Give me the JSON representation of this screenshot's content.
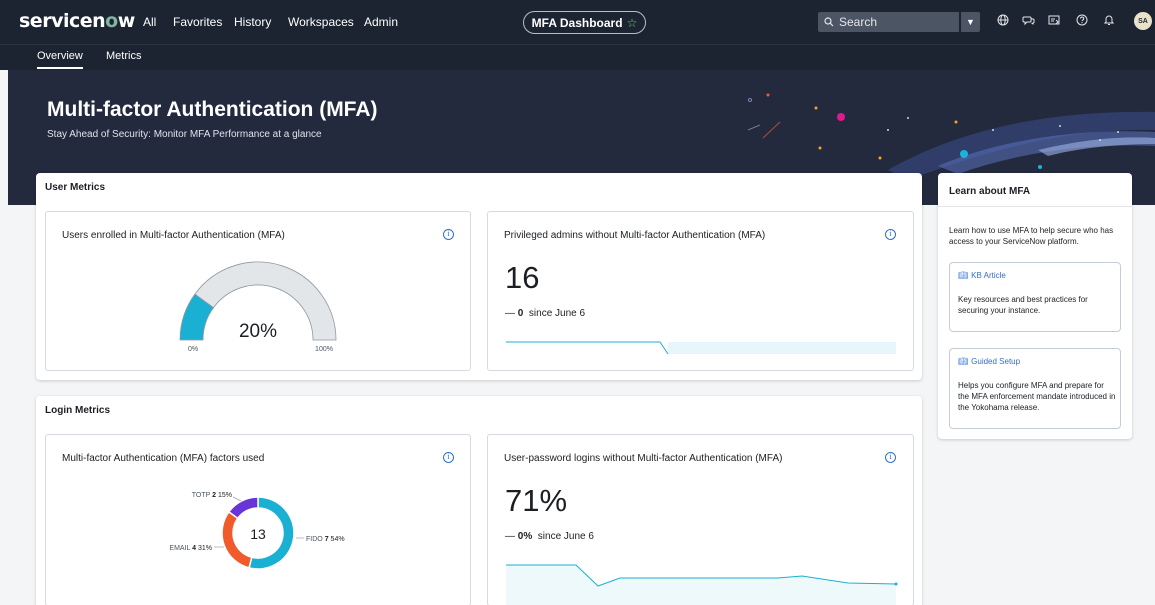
{
  "nav": {
    "logo_a": "servicen",
    "logo_o": "o",
    "logo_b": "w",
    "links": [
      "All",
      "Favorites",
      "History",
      "Workspaces",
      "Admin"
    ],
    "dashboard_pill": "MFA Dashboard",
    "search_placeholder": "Search",
    "avatar": "SA"
  },
  "tabs": [
    "Overview",
    "Metrics"
  ],
  "banner": {
    "title": "Multi-factor Authentication (MFA)",
    "subtitle": "Stay Ahead of Security: Monitor MFA Performance at a glance"
  },
  "user_metrics": {
    "title": "User Metrics",
    "enrolled": {
      "title": "Users enrolled in Multi-factor Authentication (MFA)",
      "value_label": "20%",
      "value": 20,
      "min_label": "0%",
      "max_label": "100%"
    },
    "privileged": {
      "title": "Privileged admins without Multi-factor Authentication (MFA)",
      "value": "16",
      "change": "0",
      "since": "since June 6"
    }
  },
  "login_metrics": {
    "title": "Login Metrics",
    "factors": {
      "title": "Multi-factor Authentication (MFA) factors used",
      "total": "13",
      "slices": [
        {
          "name": "FIDO",
          "count": "7",
          "pct": "54%",
          "value": 54,
          "color": "#1ab0d3"
        },
        {
          "name": "EMAIL",
          "count": "4",
          "pct": "31%",
          "value": 31,
          "color": "#f15a2b"
        },
        {
          "name": "TOTP",
          "count": "2",
          "pct": "15%",
          "value": 15,
          "color": "#6a35d6"
        }
      ]
    },
    "password": {
      "title": "User-password logins without Multi-factor Authentication (MFA)",
      "value": "71%",
      "change": "0%",
      "since": "since June 6"
    }
  },
  "learn": {
    "title": "Learn about MFA",
    "description": "Learn how to use MFA to help secure who has access to your ServiceNow platform.",
    "cards": [
      {
        "link": "KB Article",
        "text": "Key resources and best practices for securing your instance."
      },
      {
        "link": "Guided Setup",
        "text": "Helps you configure MFA and prepare for the MFA enforcement mandate introduced in the Yokohama release."
      }
    ]
  },
  "colors": {
    "nav_bg": "#1c2431",
    "banner_bg": "#242a3e",
    "gauge_fill": "#1ab0d3",
    "gauge_track": "#e3e6e8",
    "link": "#2f6ecf"
  }
}
